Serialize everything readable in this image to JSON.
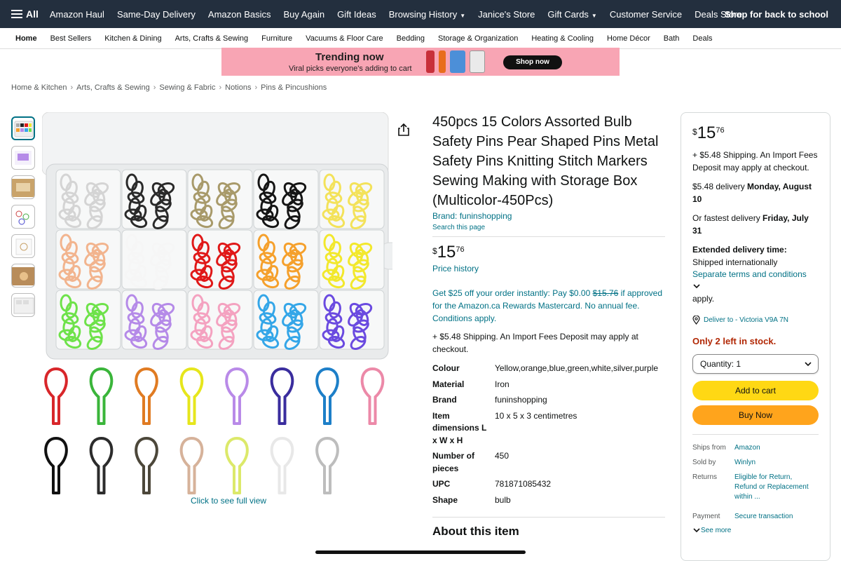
{
  "top_nav": {
    "all_label": "All",
    "items": [
      "Amazon Haul",
      "Same-Day Delivery",
      "Amazon Basics",
      "Buy Again",
      "Gift Ideas",
      "Browsing History",
      "Janice's Store",
      "Gift Cards",
      "Customer Service",
      "Deals Store"
    ],
    "promo": "Shop for back to school"
  },
  "sub_nav": {
    "items": [
      "Home",
      "Best Sellers",
      "Kitchen & Dining",
      "Arts, Crafts & Sewing",
      "Furniture",
      "Vacuums & Floor Care",
      "Bedding",
      "Storage & Organization",
      "Heating & Cooling",
      "Home Décor",
      "Bath",
      "Deals"
    ]
  },
  "banner": {
    "headline": "Trending now",
    "subline": "Viral picks everyone's adding to cart",
    "button": "Shop now"
  },
  "breadcrumb": [
    "Home & Kitchen",
    "Arts, Crafts & Sewing",
    "Sewing & Fabric",
    "Notions",
    "Pins & Pincushions"
  ],
  "gallery": {
    "click_label": "Click to see full view",
    "box_colors": [
      "#d4d4d4",
      "#2a2a2a",
      "#a89a6a",
      "#151515",
      "#f3e25a",
      "#f2b48e",
      "#f6f6f6",
      "#e01818",
      "#f5a02c",
      "#f2e82c",
      "#6ee24a",
      "#b58ae8",
      "#f4a2c0",
      "#34a6e8",
      "#6a4ae0"
    ],
    "pin_colors_row1": [
      "#d8262a",
      "#3ab53a",
      "#e07b22",
      "#e6e61c",
      "#b98ae8",
      "#3a2d9e",
      "#1d7fc8",
      "#ec89a8"
    ],
    "pin_colors_row2": [
      "#111111",
      "#2c2c2c",
      "#4c473a",
      "#d6b29a",
      "#dce96a",
      "#e8e8e8",
      "#bdbdbd"
    ]
  },
  "product": {
    "title": "450pcs 15 Colors Assorted Bulb Safety Pins Pear Shaped Pins Metal Safety Pins Knitting Stitch Markers Sewing Making with Storage Box (Multicolor-450Pcs)",
    "brand": "Brand: funinshopping",
    "search": "Search this page",
    "price": {
      "symbol": "$",
      "whole": "15",
      "fraction": "76"
    },
    "price_history": "Price history",
    "offer": {
      "before": "Get $25 off your order instantly: Pay $0.00 ",
      "strike": "$15.76",
      "after": " if approved for the Amazon.ca Rewards Mastercard. No annual fee. Conditions apply."
    },
    "shipping": "+ $5.48 Shipping. An Import Fees Deposit may apply at checkout.",
    "specs": [
      {
        "key": "Colour",
        "value": "Yellow,orange,blue,green,white,silver,purple"
      },
      {
        "key": "Material",
        "value": "Iron"
      },
      {
        "key": "Brand",
        "value": "funinshopping"
      },
      {
        "key": "Item dimensions L x W x H",
        "value": "10 x 5 x 3 centimetres"
      },
      {
        "key": "Number of pieces",
        "value": "450"
      },
      {
        "key": "UPC",
        "value": "781871085432"
      },
      {
        "key": "Shape",
        "value": "bulb"
      }
    ],
    "about_heading": "About this item"
  },
  "buybox": {
    "price": {
      "symbol": "$",
      "whole": "15",
      "fraction": "76"
    },
    "shipping": "+ $5.48 Shipping. An Import Fees Deposit may apply at checkout.",
    "delivery_prefix": "$5.48 delivery ",
    "delivery_date": "Monday, August 10",
    "fastest_prefix": "Or fastest delivery ",
    "fastest_date": "Friday, July 31",
    "extended_title": "Extended delivery time:",
    "extended_line": "Shipped internationally",
    "separate_terms": "Separate terms and conditions",
    "apply": "apply.",
    "deliver_to": "Deliver to - Victoria V9A 7N",
    "stock": "Only 2 left in stock.",
    "quantity_label": "Quantity:",
    "quantity_value": "1",
    "add_to_cart": "Add to cart",
    "buy_now": "Buy Now",
    "meta": [
      {
        "key": "Ships from",
        "value": "Amazon"
      },
      {
        "key": "Sold by",
        "value": "Winlyn"
      },
      {
        "key": "Returns",
        "value": "Eligible for Return, Refund or Replacement within ..."
      },
      {
        "key": "Payment",
        "value": "Secure transaction"
      }
    ],
    "see_more": "See more"
  },
  "colors": {
    "nav_bg": "#232f3e",
    "link": "#007185",
    "add_to_cart": "#ffd814",
    "buy_now": "#ffa41c",
    "stock": "#b12704"
  }
}
